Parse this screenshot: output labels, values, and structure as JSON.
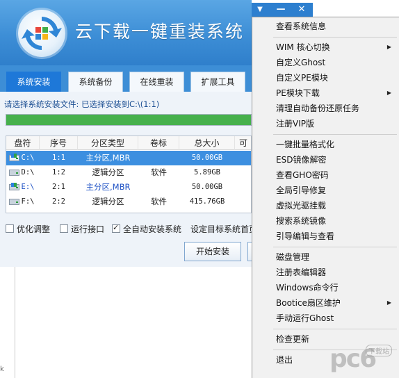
{
  "app": {
    "title": "云下载一键重装系统",
    "tabs": [
      {
        "label": "系统安装",
        "active": true
      },
      {
        "label": "系统备份",
        "active": false
      },
      {
        "label": "在线重装",
        "active": false
      },
      {
        "label": "扩展工具",
        "active": false
      }
    ],
    "install_info": "请选择系统安装文件: 已选择安装到C:\\(1:1)",
    "progress_fraction": 1.0,
    "table": {
      "headers": [
        "盘符",
        "序号",
        "分区类型",
        "卷标",
        "总大小",
        "可"
      ],
      "rows": [
        {
          "drive": "C:\\",
          "index": "1:1",
          "type": "主分区,MBR",
          "label": "",
          "size": "50.00GB",
          "selected": true,
          "system": true
        },
        {
          "drive": "D:\\",
          "index": "1:2",
          "type": "逻辑分区",
          "label": "软件",
          "size": "5.89GB",
          "selected": false,
          "system": false
        },
        {
          "drive": "E:\\",
          "index": "2:1",
          "type": "主分区,MBR",
          "label": "",
          "size": "50.00GB",
          "selected": false,
          "system": true
        },
        {
          "drive": "F:\\",
          "index": "2:2",
          "type": "逻辑分区",
          "label": "软件",
          "size": "415.76GB",
          "selected": false,
          "system": false
        }
      ]
    },
    "options": [
      {
        "label": "优化调整",
        "checked": false
      },
      {
        "label": "运行接口",
        "checked": false
      },
      {
        "label": "全自动安装系统",
        "checked": true
      },
      {
        "label": "设定目标系统首页",
        "checked": false
      }
    ],
    "start_button": "开始安装"
  },
  "titlebar": {
    "icons": [
      "menu-dropdown-icon",
      "minimize-icon",
      "close-icon"
    ],
    "glyphs": [
      "▼",
      "—",
      "✕"
    ]
  },
  "menu": {
    "groups": [
      [
        {
          "label": "查看系统信息",
          "submenu": false
        }
      ],
      [
        {
          "label": "WIM 核心切换",
          "submenu": true
        },
        {
          "label": "自定义Ghost",
          "submenu": false
        },
        {
          "label": "自定义PE模块",
          "submenu": false
        },
        {
          "label": "PE模块下载",
          "submenu": true
        },
        {
          "label": "清理自动备份还原任务",
          "submenu": false
        },
        {
          "label": "注册VIP版",
          "submenu": false
        }
      ],
      [
        {
          "label": "一键批量格式化",
          "submenu": false
        },
        {
          "label": "ESD镜像解密",
          "submenu": false
        },
        {
          "label": "查看GHO密码",
          "submenu": false
        },
        {
          "label": "全局引导修复",
          "submenu": false
        },
        {
          "label": "虚拟光驱挂载",
          "submenu": false
        },
        {
          "label": "搜索系统镜像",
          "submenu": false
        },
        {
          "label": "引导编辑与查看",
          "submenu": false
        }
      ],
      [
        {
          "label": "磁盘管理",
          "submenu": false
        },
        {
          "label": "注册表编辑器",
          "submenu": false
        },
        {
          "label": "Windows命令行",
          "submenu": false
        },
        {
          "label": "Bootice扇区维护",
          "submenu": true
        },
        {
          "label": "手动运行Ghost",
          "submenu": false
        }
      ],
      [
        {
          "label": "检查更新",
          "submenu": false
        }
      ],
      [
        {
          "label": "退出",
          "submenu": false
        }
      ]
    ],
    "submenu_arrow": "▶"
  },
  "watermark": {
    "main": "pc6",
    "sub": "下载站"
  },
  "edge_mark": "k",
  "colors": {
    "header": "#3d8ed6",
    "tab_active": "#1e78d8",
    "row_selected": "#3c8fe0",
    "progress": "#46b04c",
    "menu_bg": "#f1f1f1"
  }
}
